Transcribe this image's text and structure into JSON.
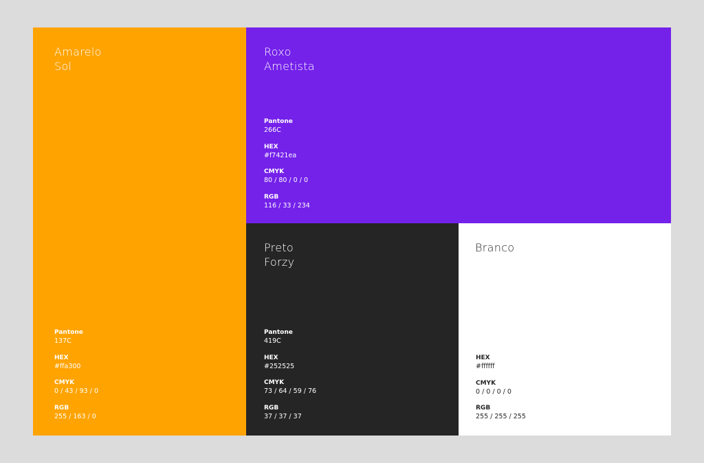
{
  "swatches": {
    "yellow": {
      "name_line1": "Amarelo",
      "name_line2": "Sol",
      "color": "#ffa300",
      "specs": [
        {
          "label": "Pantone",
          "value": "137C"
        },
        {
          "label": "HEX",
          "value": "#ffa300"
        },
        {
          "label": "CMYK",
          "value": "0 / 43 / 93 / 0"
        },
        {
          "label": "RGB",
          "value": "255 / 163 / 0"
        }
      ]
    },
    "purple": {
      "name_line1": "Roxo",
      "name_line2": "Ametista",
      "color": "#7421ea",
      "specs": [
        {
          "label": "Pantone",
          "value": "266C"
        },
        {
          "label": "HEX",
          "value": "#f7421ea"
        },
        {
          "label": "CMYK",
          "value": "80 / 80 / 0 / 0"
        },
        {
          "label": "RGB",
          "value": "116 / 33 / 234"
        }
      ]
    },
    "black": {
      "name_line1": "Preto",
      "name_line2": "Forzy",
      "color": "#252525",
      "specs": [
        {
          "label": "Pantone",
          "value": "419C"
        },
        {
          "label": "HEX",
          "value": "#252525"
        },
        {
          "label": "CMYK",
          "value": "73 / 64 / 59 / 76"
        },
        {
          "label": "RGB",
          "value": "37 / 37 / 37"
        }
      ]
    },
    "white": {
      "name_line1": "Branco",
      "color": "#ffffff",
      "specs": [
        {
          "label": "HEX",
          "value": "#ffffff"
        },
        {
          "label": "CMYK",
          "value": "0 / 0 / 0 / 0"
        },
        {
          "label": "RGB",
          "value": "255 / 255 / 255"
        }
      ]
    }
  }
}
